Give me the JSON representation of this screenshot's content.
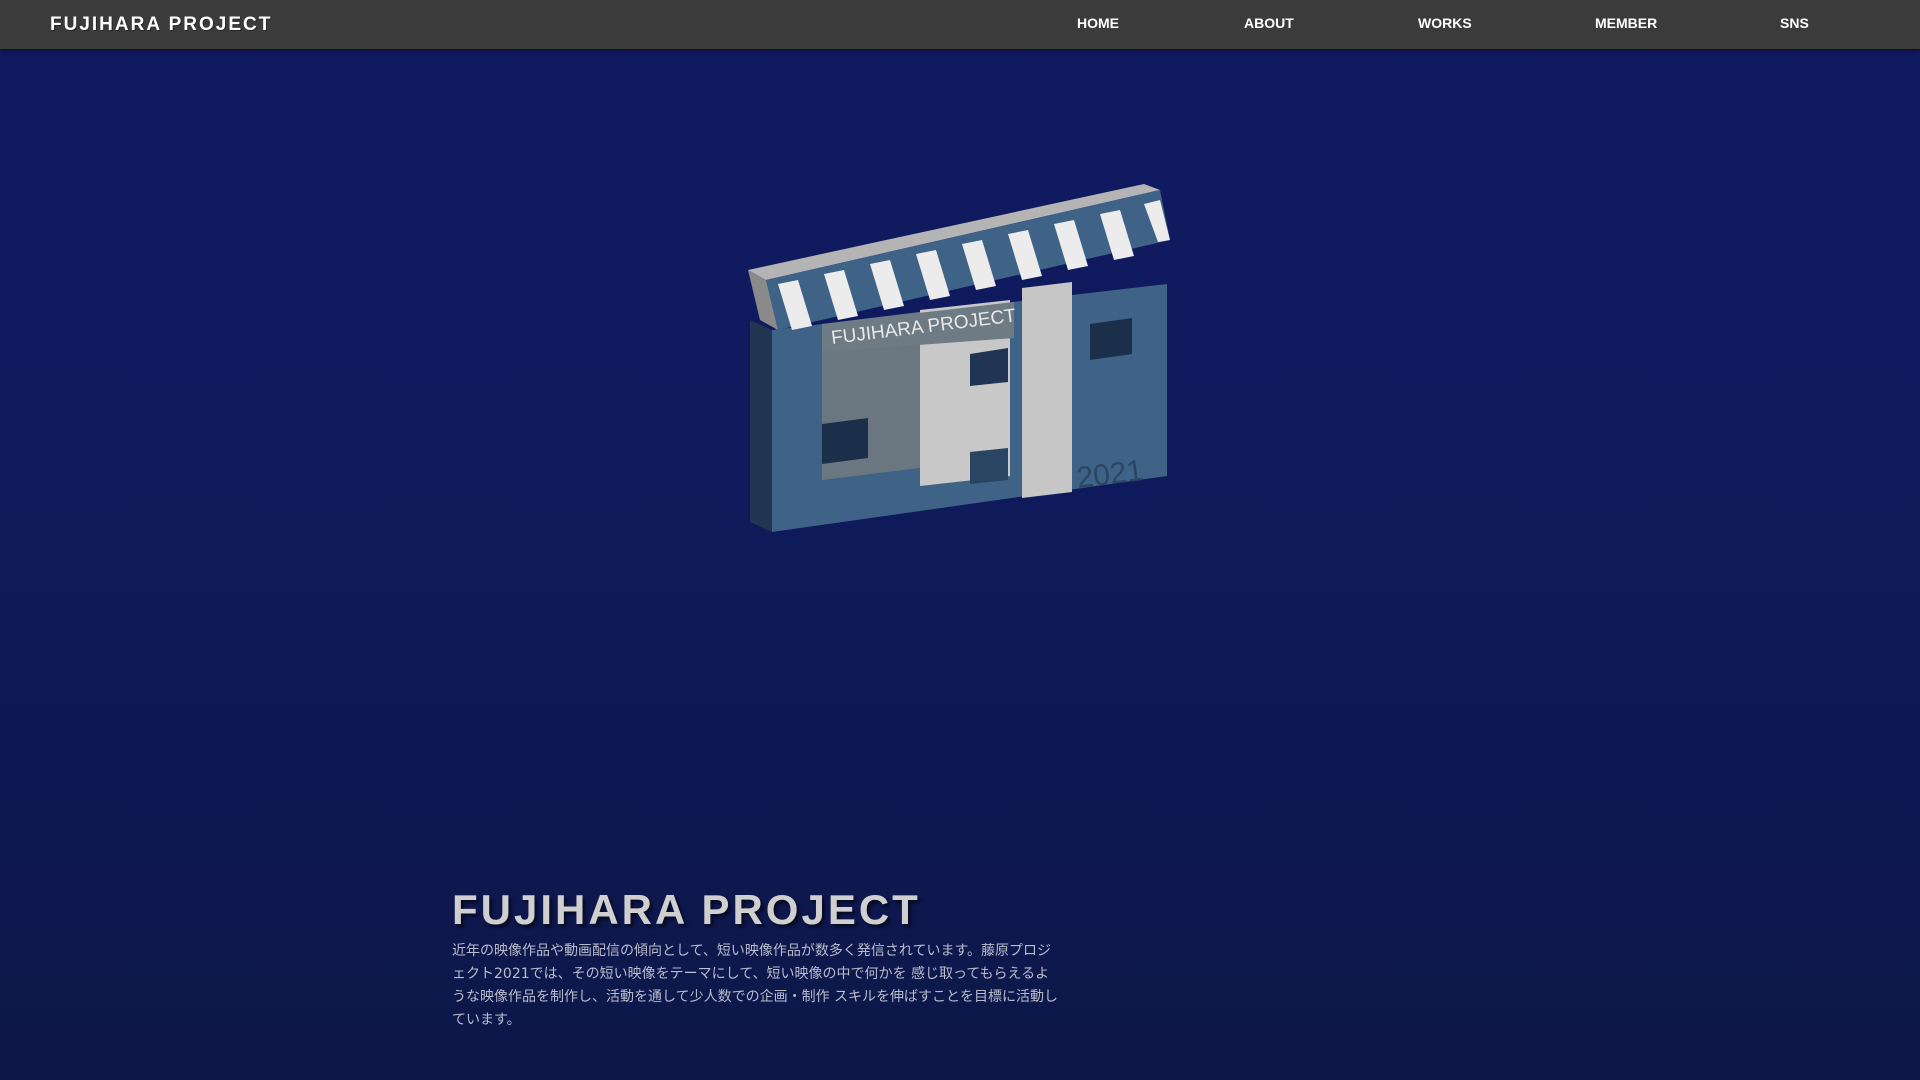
{
  "header": {
    "brand": "FUJIHARA PROJECT",
    "nav": [
      {
        "label": "HOME"
      },
      {
        "label": "ABOUT"
      },
      {
        "label": "WORKS"
      },
      {
        "label": "MEMBER"
      },
      {
        "label": "SNS"
      }
    ]
  },
  "hero_logo": {
    "icon": "clapperboard-logo-icon",
    "board_text": "FUJIHARA PROJECT",
    "letters": "FHP",
    "year": "2021"
  },
  "intro": {
    "title": "FUJIHARA PROJECT",
    "text": "近年の映像作品や動画配信の傾向として、短い映像作品が数多く発信されています。藤原プロジェクト2021では、その短い映像をテーマにして、短い映像の中で何かを 感じ取ってもらえるような映像作品を制作し、活動を通して少人数での企画・制作 スキルを伸ばすことを目標に活動しています。"
  },
  "colors": {
    "background": "#101a62",
    "navbar": "#3b3b3b",
    "logo_blue": "#3e6386",
    "logo_gray": "#c7c7c7"
  }
}
